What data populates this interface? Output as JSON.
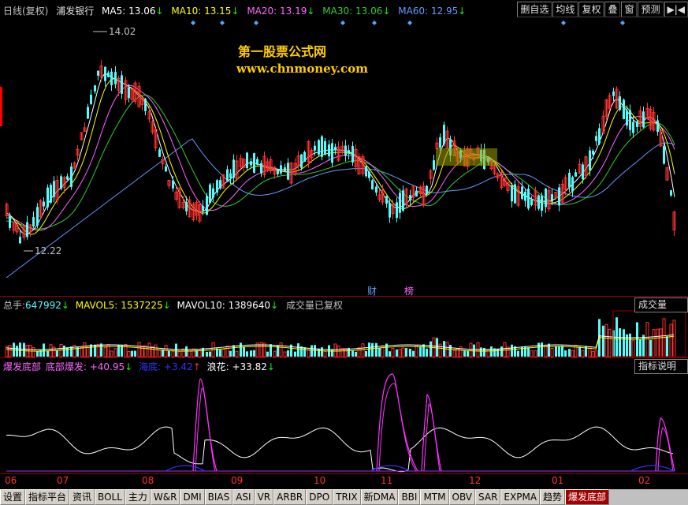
{
  "header": {
    "period": "日线(复权)",
    "stock": "浦发银行",
    "ma5": {
      "label": "MA5:",
      "value": "13.06",
      "arrow": "↓",
      "color": "#ffffff"
    },
    "ma10": {
      "label": "MA10:",
      "value": "13.15",
      "arrow": "↓",
      "color": "#ffff00"
    },
    "ma20": {
      "label": "MA20:",
      "value": "13.19",
      "arrow": "↓",
      "color": "#ff66ff"
    },
    "ma30": {
      "label": "MA30:",
      "value": "13.06",
      "arrow": "↓",
      "color": "#33cc33"
    },
    "ma60": {
      "label": "MA60:",
      "value": "12.95",
      "arrow": "↓",
      "color": "#6699ff"
    }
  },
  "toolbar": [
    "删自选",
    "均线",
    "复权",
    "叠",
    "窗",
    "预测",
    "▶|◀"
  ],
  "watermark": {
    "title": "第一股票公式网",
    "url": "www.chnmoney.com"
  },
  "price_marks": {
    "high": "14.02",
    "low": "12.22"
  },
  "events": {
    "cai": "财",
    "bang": "榜"
  },
  "volume_panel": {
    "total_label": "总手:",
    "total_value": "647992",
    "total_arrow": "↓",
    "mavol5_label": "MAVOL5:",
    "mavol5_value": "1537225",
    "mavol5_arrow": "↓",
    "mavol10_label": "MAVOL10:",
    "mavol10_value": "1389640",
    "mavol10_arrow": "↓",
    "note": "成交量已复权",
    "button": "成交量"
  },
  "indicator_panel": {
    "name": "爆发底部",
    "line1_label": "底部爆发:",
    "line1_value": "+40.95",
    "line1_arrow": "↓",
    "line2_label": "海底:",
    "line2_value": "+3.42",
    "line2_arrow": "↑",
    "line3_label": "浪花:",
    "line3_value": "+33.82",
    "line3_arrow": "↓",
    "button": "指标说明"
  },
  "x_axis": [
    "06",
    "07",
    "08",
    "09",
    "10",
    "11",
    "12",
    "01",
    "02"
  ],
  "tabs": [
    "设置",
    "指标平台",
    "资讯",
    "BOLL",
    "主力",
    "W&R",
    "DMI",
    "BIAS",
    "ASI",
    "VR",
    "ARBR",
    "DPO",
    "TRIX",
    "新DMA",
    "BBI",
    "MTM",
    "OBV",
    "SAR",
    "EXPMA",
    "趋势",
    "爆发底部"
  ],
  "active_tab": "爆发底部",
  "colors": {
    "up": "#ff3232",
    "down": "#54fcfc",
    "ma5": "#ffffff",
    "ma10": "#ffff00",
    "ma20": "#ff66ff",
    "ma30": "#33cc33",
    "ma60": "#6699ff",
    "accent": "#a00000"
  }
}
